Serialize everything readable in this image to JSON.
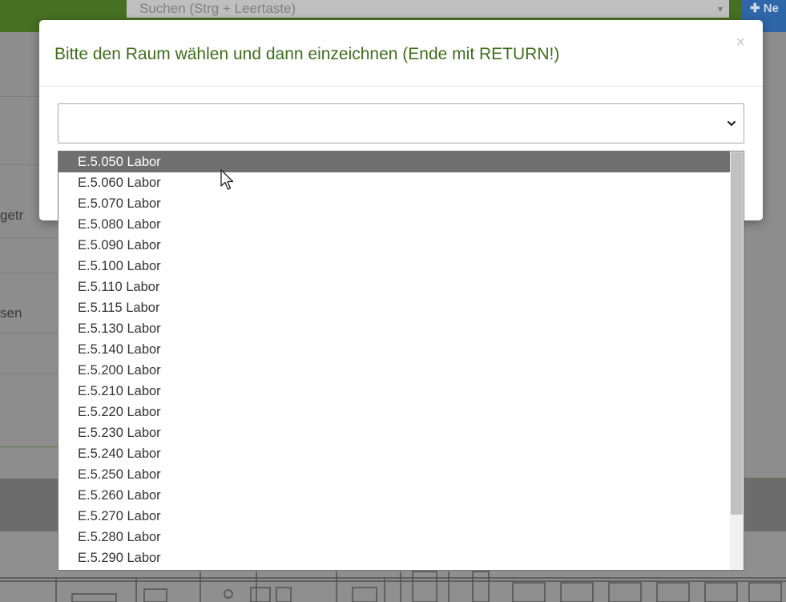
{
  "background": {
    "search_placeholder": "Suchen (Strg + Leertaste)",
    "new_button_label": "Ne",
    "side_text_1": "getr",
    "side_text_2": "sen"
  },
  "modal": {
    "title": "Bitte den Raum wählen und dann einzeichnen (Ende mit RETURN!)",
    "close_glyph": "×",
    "select_value": ""
  },
  "dropdown": {
    "options": [
      {
        "label": "E.5.050 Labor",
        "selected": true
      },
      {
        "label": "E.5.060 Labor"
      },
      {
        "label": "E.5.070 Labor"
      },
      {
        "label": "E.5.080 Labor"
      },
      {
        "label": "E.5.090 Labor"
      },
      {
        "label": "E.5.100 Labor"
      },
      {
        "label": "E.5.110 Labor"
      },
      {
        "label": "E.5.115 Labor"
      },
      {
        "label": "E.5.130 Labor"
      },
      {
        "label": "E.5.140 Labor"
      },
      {
        "label": "E.5.200 Labor"
      },
      {
        "label": "E.5.210 Labor"
      },
      {
        "label": "E.5.220 Labor"
      },
      {
        "label": "E.5.230 Labor"
      },
      {
        "label": "E.5.240 Labor"
      },
      {
        "label": "E.5.250 Labor"
      },
      {
        "label": "E.5.260 Labor"
      },
      {
        "label": "E.5.270 Labor"
      },
      {
        "label": "E.5.280 Labor"
      },
      {
        "label": "E.5.290 Labor"
      }
    ]
  },
  "colors": {
    "title_green": "#3f6e1c",
    "selected_bg": "#6f6f6f",
    "topbar_green": "#477022",
    "new_button_blue": "#2e66a8"
  },
  "icons": {
    "close": "close-icon",
    "select_caret": "chevron-down-icon",
    "cursor": "mouse-pointer-icon",
    "plus": "plus-icon"
  }
}
